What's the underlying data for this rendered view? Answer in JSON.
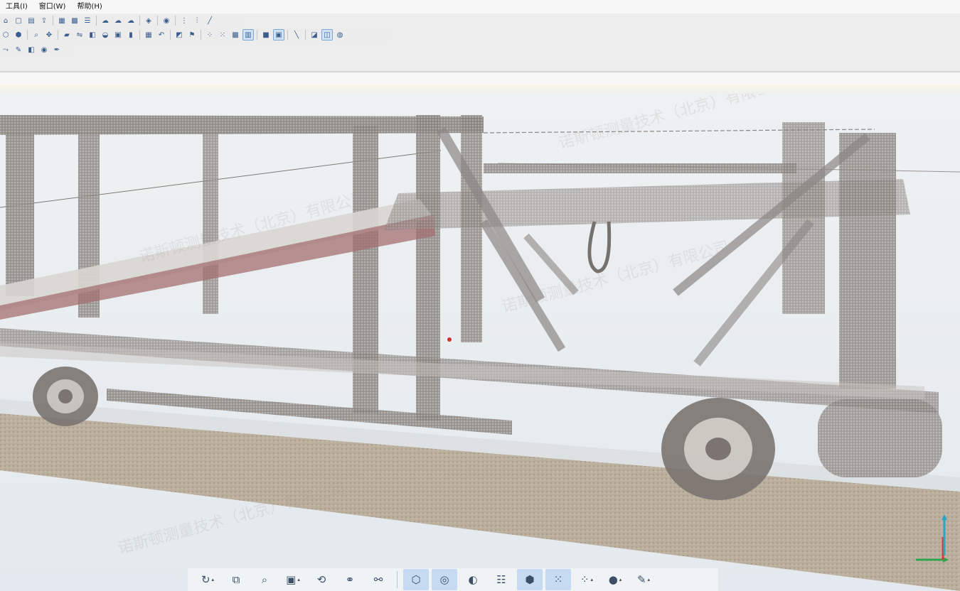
{
  "menu": {
    "items": [
      "工具(I)",
      "窗口(W)",
      "帮助(H)"
    ]
  },
  "toolbar1": {
    "icons": [
      "home-icon",
      "open-icon",
      "save-icon",
      "export-icon",
      "layer-icon",
      "grid-view-icon",
      "list-icon",
      "cloud-icon",
      "cloud-filter-icon",
      "cloud-merge-icon",
      "color-icon",
      "globe-icon",
      "segment-icon",
      "measure-icon",
      "line-icon"
    ]
  },
  "toolbar2": {
    "icons": [
      "cube-icon",
      "cube-wire-icon",
      "zoom-icon",
      "pan-icon",
      "camera-icon",
      "split-icon",
      "classify-icon",
      "render-icon",
      "mesh-icon",
      "tag-icon",
      "grid-icon",
      "rotate-icon",
      "plane-icon",
      "flag-icon",
      "dots-icon",
      "dots-grid-icon",
      "dense-grid-icon",
      "grid-fine-icon",
      "square-icon",
      "frame-icon",
      "line-tool-icon",
      "view-box-icon",
      "active-box-icon",
      "sphere-icon"
    ]
  },
  "toolbar3": {
    "icons": [
      "vector-icon",
      "brush-icon",
      "layers-icon",
      "palette-icon",
      "pen-icon"
    ]
  },
  "watermark": {
    "text": "诺斯顿测量技术（北京）有限公司"
  },
  "bottom_toolbar": {
    "buttons": [
      {
        "icon": "orbit-icon",
        "caret": "▴"
      },
      {
        "icon": "copy-view-icon",
        "caret": ""
      },
      {
        "icon": "zoom-icon",
        "caret": ""
      },
      {
        "icon": "cube-view-icon",
        "caret": "▴"
      },
      {
        "icon": "rotate-icon",
        "caret": ""
      },
      {
        "icon": "link-icon",
        "caret": ""
      },
      {
        "icon": "measure-icon",
        "caret": ""
      },
      {
        "icon": "box-select-icon",
        "caret": ""
      },
      {
        "icon": "loop-icon",
        "caret": ""
      },
      {
        "icon": "eye-icon",
        "caret": ""
      },
      {
        "icon": "list-icon",
        "caret": ""
      },
      {
        "icon": "wire-cube-icon",
        "caret": ""
      },
      {
        "icon": "point-grid-icon",
        "caret": ""
      },
      {
        "icon": "dots-icon",
        "caret": "▴"
      },
      {
        "icon": "color-wheel-icon",
        "caret": "▴"
      },
      {
        "icon": "paint-icon",
        "caret": "▴"
      }
    ]
  },
  "colors": {
    "accent": "#7ea7d8",
    "active": "#c6dbf1",
    "axis_x": "#2ea44f",
    "axis_y": "#e0373b",
    "axis_z": "#2aa6c9"
  }
}
